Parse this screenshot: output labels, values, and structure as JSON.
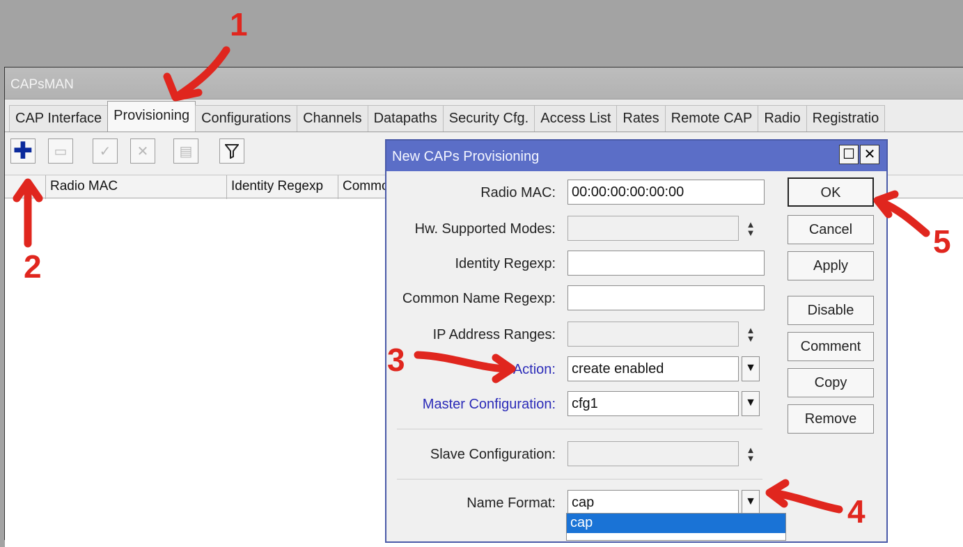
{
  "window": {
    "title": "CAPsMAN"
  },
  "tabs": [
    "CAP Interface",
    "Provisioning",
    "Configurations",
    "Channels",
    "Datapaths",
    "Security Cfg.",
    "Access List",
    "Rates",
    "Remote CAP",
    "Radio",
    "Registratio"
  ],
  "active_tab": "Provisioning",
  "toolbar": {
    "add_icon": "plus-icon",
    "remove_icon": "minus-icon",
    "enable_icon": "check-icon",
    "disable_icon": "cross-icon",
    "comment_icon": "comment-icon",
    "filter_icon": "filter-icon"
  },
  "table": {
    "columns": [
      "Radio MAC",
      "Identity Regexp",
      "Commo"
    ]
  },
  "dialog": {
    "title": "New CAPs Provisioning",
    "maximize_icon": "maximize-icon",
    "close_icon": "close-icon",
    "fields": {
      "radio_mac": {
        "label": "Radio MAC:",
        "value": "00:00:00:00:00:00"
      },
      "hw_modes": {
        "label": "Hw. Supported Modes:",
        "value": ""
      },
      "identity_regexp": {
        "label": "Identity Regexp:",
        "value": ""
      },
      "common_name_regexp": {
        "label": "Common Name Regexp:",
        "value": ""
      },
      "ip_ranges": {
        "label": "IP Address Ranges:",
        "value": ""
      },
      "action": {
        "label": "Action:",
        "value": "create enabled"
      },
      "master_cfg": {
        "label": "Master Configuration:",
        "value": "cfg1"
      },
      "slave_cfg": {
        "label": "Slave Configuration:",
        "value": ""
      },
      "name_format": {
        "label": "Name Format:",
        "value": "cap"
      }
    },
    "dropdown_option": "cap",
    "buttons": {
      "ok": "OK",
      "cancel": "Cancel",
      "apply": "Apply",
      "disable": "Disable",
      "comment": "Comment",
      "copy": "Copy",
      "remove": "Remove"
    }
  },
  "annotations": {
    "color": "#e0261e",
    "steps": [
      "1",
      "2",
      "3",
      "4",
      "5"
    ]
  }
}
